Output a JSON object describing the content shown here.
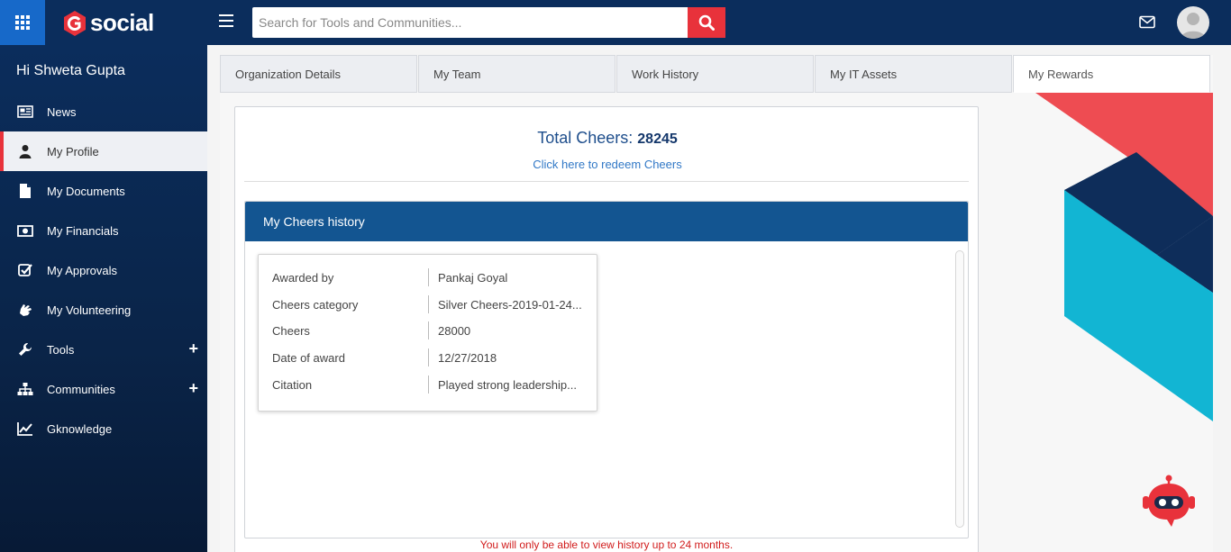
{
  "header": {
    "logo_text": "social",
    "search_placeholder": "Search for Tools and Communities...",
    "brand_color": "#0b2d5c",
    "accent_color": "#e8323b"
  },
  "sidebar": {
    "greeting": "Hi Shweta Gupta",
    "items": [
      {
        "label": "News",
        "icon": "newspaper-icon"
      },
      {
        "label": "My Profile",
        "icon": "user-icon",
        "active": true
      },
      {
        "label": "My Documents",
        "icon": "document-icon"
      },
      {
        "label": "My Financials",
        "icon": "money-icon"
      },
      {
        "label": "My Approvals",
        "icon": "checkbox-icon"
      },
      {
        "label": "My Volunteering",
        "icon": "hand-icon"
      },
      {
        "label": "Tools",
        "icon": "wrench-icon",
        "expand": "+"
      },
      {
        "label": "Communities",
        "icon": "sitemap-icon",
        "expand": "+"
      },
      {
        "label": "Gknowledge",
        "icon": "chart-line-icon"
      }
    ]
  },
  "tabs": [
    {
      "label": "Organization Details"
    },
    {
      "label": "My Team"
    },
    {
      "label": "Work History"
    },
    {
      "label": "My IT Assets"
    },
    {
      "label": "My Rewards",
      "active": true
    }
  ],
  "rewards": {
    "total_label": "Total Cheers:",
    "total_value": "28245",
    "redeem_link": "Click here to redeem Cheers",
    "history_title": "My Cheers history",
    "entry": {
      "awarded_by_label": "Awarded by",
      "awarded_by": "Pankaj Goyal",
      "category_label": "Cheers category",
      "category": "Silver Cheers-2019-01-24...",
      "cheers_label": "Cheers",
      "cheers": "28000",
      "date_label": "Date of award",
      "date": "12/27/2018",
      "citation_label": "Citation",
      "citation": "Played strong leadership..."
    },
    "notice": "You will only be able to view history up to 24 months."
  }
}
